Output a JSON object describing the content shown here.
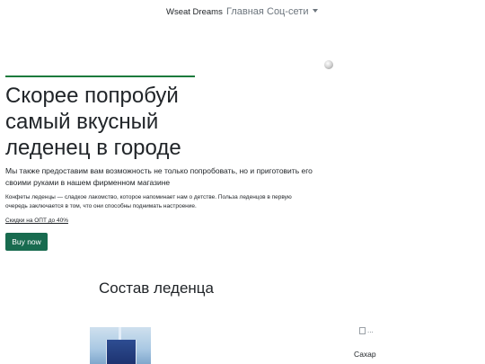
{
  "nav": {
    "brand": "Wseat Dreams",
    "home": "Главная",
    "social": "Соц-сети"
  },
  "hero": {
    "title_lines": [
      "Скорее попробуй",
      "самый вкусный",
      "леденец в городе"
    ],
    "lead": "Мы также предоставим вам возможность не только попробовать, но и приготовить его своими руками в нашем фирменном магазине",
    "description": "Конфеты леденцы — сладкое лакомство, которое напоминает нам о детстве. Польза леденцов в первую очередь заключается в том, что они способны поднимать настроение.",
    "discount_link": "Скидки на ОПТ до 40%",
    "buy_button": "Buy now"
  },
  "section": {
    "title": "Состав леденца",
    "items": [
      {
        "image": "water-glass-photo"
      },
      {
        "image_alt": "...",
        "caption": "Сахар"
      }
    ]
  },
  "colors": {
    "accent_rule": "#1c7a3c",
    "button": "#186b4f",
    "nav_link": "#6c757d"
  }
}
